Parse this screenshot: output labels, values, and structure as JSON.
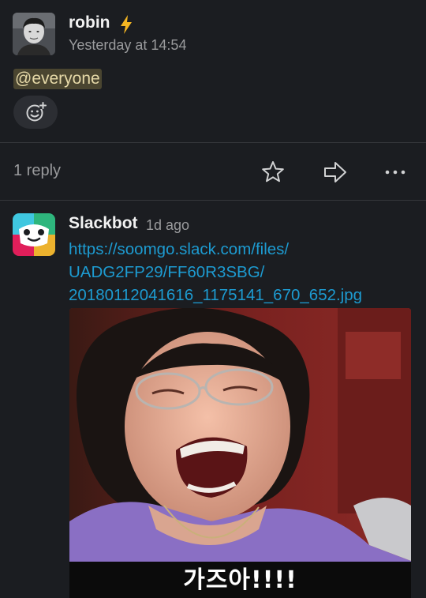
{
  "original_message": {
    "sender": "robin",
    "status_icon": "lightning-bolt-icon",
    "timestamp": "Yesterday at 14:54",
    "text": "@everyone",
    "reaction_icon": "add-reaction-icon"
  },
  "thread_actions": {
    "reply_count": "1 reply",
    "icons": [
      "star-icon",
      "share-icon",
      "more-icon"
    ]
  },
  "reply_message": {
    "sender": "Slackbot",
    "timestamp": "1d ago",
    "link_lines": [
      "https://soomgo.slack.com/files/",
      "UADG2FP29/FF60R3SBG/",
      "20180112041616_1175141_670_652.jpg"
    ],
    "image_caption": "가즈아!!!!"
  },
  "colors": {
    "background": "#1b1d21",
    "link": "#1d9bd1",
    "mention_bg": "#4a4530",
    "bolt": "#f5b622"
  }
}
